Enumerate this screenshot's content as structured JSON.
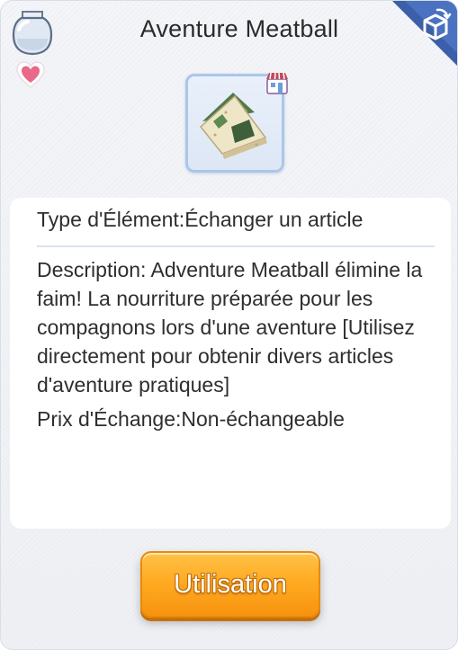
{
  "header": {
    "title": "Aventure Meatball",
    "left_icons": [
      "jar-icon",
      "heart-icon"
    ],
    "corner_icon": "cube-return-icon"
  },
  "item": {
    "icon": "sandwich-food-icon",
    "badge_icon": "shop-icon"
  },
  "info": {
    "type_line": "Type d'Élément:Échanger un article",
    "description": "Description: Adventure Meatball élimine la faim!  La nourriture préparée pour les compagnons lors d'une aventure [Utilisez directement pour obtenir divers articles d'aventure pratiques]",
    "price_line": "Prix d'Échange:Non-échangeable"
  },
  "actions": {
    "use_label": "Utilisation"
  },
  "colors": {
    "button_orange": "#ffab22",
    "corner_blue": "#3b5fa8",
    "item_border": "#a9c7ea",
    "heart_pink": "#e86a88"
  }
}
